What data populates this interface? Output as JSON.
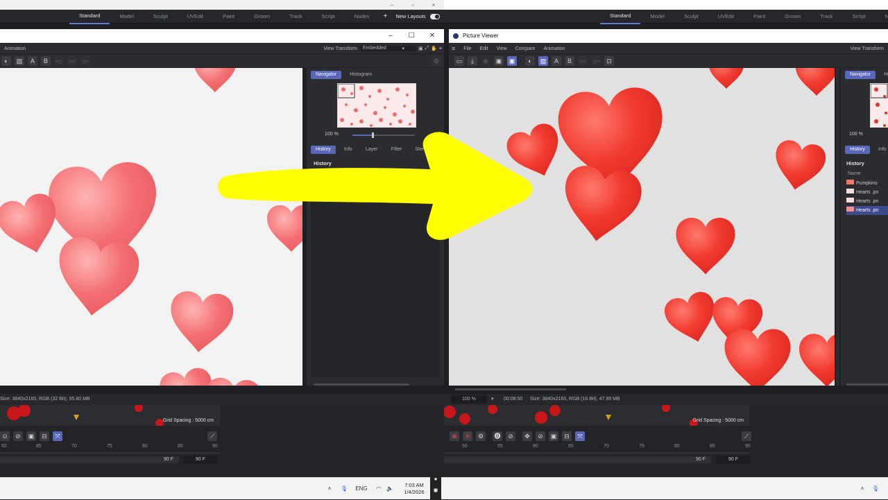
{
  "layouts": {
    "left": [
      "Standard",
      "Model",
      "Sculpt",
      "UVEdit",
      "Paint",
      "Groom",
      "Track",
      "Script",
      "Nodes"
    ],
    "right": [
      "Standard",
      "Model",
      "Sculpt",
      "UVEdit",
      "Paint",
      "Groom",
      "Track",
      "Script",
      "Nodes"
    ],
    "new_layouts_label": "New Layouts",
    "plus": "+"
  },
  "left_window": {
    "menu_animation": "Animation",
    "view_transform_label": "View Transform",
    "view_transform_value": "Embedded",
    "navigator_tabs": [
      "Navigator",
      "Histogram"
    ],
    "zoom": "100 %",
    "history_tabs": [
      "History",
      "Info",
      "Layer",
      "Filter",
      "Stereo"
    ],
    "history_heading": "History",
    "status_text": "Size: 3840x2160, RGB (32 Bit), 95.80 MB",
    "grid_spacing": "Grid Spacing : 5000 cm",
    "ticks": [
      "60",
      "65",
      "70",
      "75",
      "80",
      "85",
      "90"
    ],
    "frame_end_1": "90 F",
    "frame_end_2": "90 F"
  },
  "right_window": {
    "title": "Picture Viewer",
    "menu": [
      "File",
      "Edit",
      "View",
      "Compare",
      "Animation"
    ],
    "view_transform_label": "View Transform",
    "navigator_tabs": [
      "Navigator",
      "His"
    ],
    "zoom": "100 %",
    "history_tabs": [
      "History",
      "Info"
    ],
    "history_heading": "History",
    "name_col": "Name",
    "history_items": [
      "Pumpkins",
      "Hearts .pn",
      "Hearts .pn",
      "Hearts .pn"
    ],
    "status_zoom": "100 %",
    "status_time": "00:08:50",
    "status_text": "Size: 3840x2160, RGB (16 Bit), 47.99 MB",
    "grid_spacing": "Grid Spacing : 5000 cm",
    "ticks": [
      "50",
      "55",
      "60",
      "65",
      "70",
      "75",
      "80",
      "85",
      "90"
    ],
    "frame_end_1": "90 F",
    "frame_end_2": "90 F"
  },
  "taskbar": {
    "lang": "ENG",
    "time": "7:03 AM",
    "date": "1/4/2026"
  },
  "colors": {
    "accent": "#5a67b8",
    "arrow": "#ffff00",
    "heart_left": "#f4787a",
    "heart_right": "#f0302a"
  }
}
